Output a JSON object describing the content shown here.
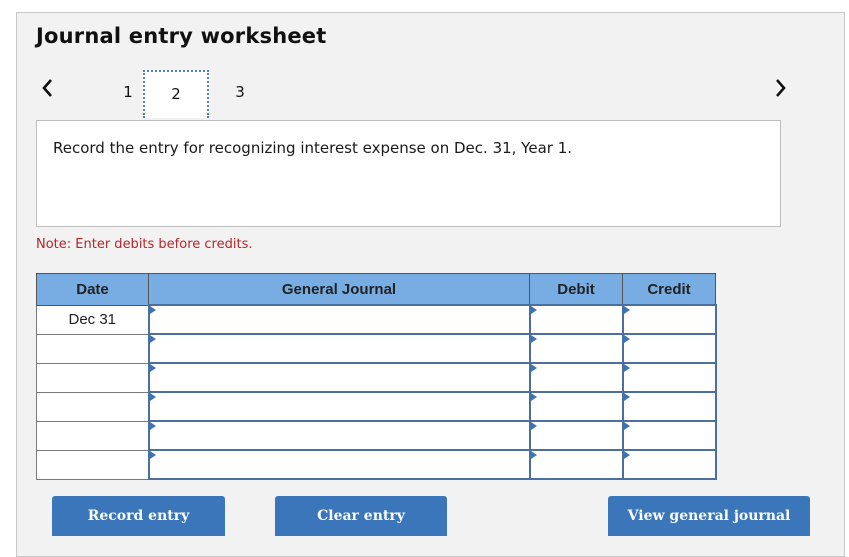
{
  "header": {
    "title": "Journal entry worksheet"
  },
  "pager": {
    "prev_icon": "chevron-left-icon",
    "next_icon": "chevron-right-icon",
    "tabs": [
      {
        "label": "1",
        "active": false
      },
      {
        "label": "2",
        "active": true
      },
      {
        "label": "3",
        "active": false
      }
    ]
  },
  "prompt": {
    "text": "Record the entry for recognizing interest expense on Dec. 31, Year 1."
  },
  "note": {
    "text": "Note: Enter debits before credits.",
    "color": "#b3262b"
  },
  "table": {
    "headers": {
      "date": "Date",
      "journal": "General Journal",
      "debit": "Debit",
      "credit": "Credit"
    },
    "header_color": "#78ade4",
    "rows": [
      {
        "date": "Dec 31",
        "account": "",
        "debit": "",
        "credit": ""
      },
      {
        "date": "",
        "account": "",
        "debit": "",
        "credit": ""
      },
      {
        "date": "",
        "account": "",
        "debit": "",
        "credit": ""
      },
      {
        "date": "",
        "account": "",
        "debit": "",
        "credit": ""
      },
      {
        "date": "",
        "account": "",
        "debit": "",
        "credit": ""
      },
      {
        "date": "",
        "account": "",
        "debit": "",
        "credit": ""
      }
    ]
  },
  "buttons": {
    "record": "Record entry",
    "clear": "Clear entry",
    "view": "View general journal",
    "color": "#3b76bb"
  }
}
